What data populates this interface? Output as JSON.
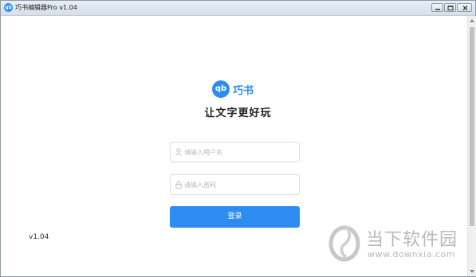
{
  "window": {
    "title": "巧书编辑器Pro v1.04",
    "app_icon": "qb-logo-icon"
  },
  "login": {
    "logo_mark": "qb",
    "logo_text": "巧书",
    "slogan": "让文字更好玩",
    "username_placeholder": "请输入用户名",
    "password_placeholder": "请输入密码",
    "login_label": "登录",
    "version": "v1.04"
  },
  "watermark": {
    "name": "当下软件园",
    "url": "www.downxia.com"
  },
  "colors": {
    "accent": "#2d8cf0",
    "placeholder": "#b5b9bf",
    "border": "#d9dde3"
  }
}
